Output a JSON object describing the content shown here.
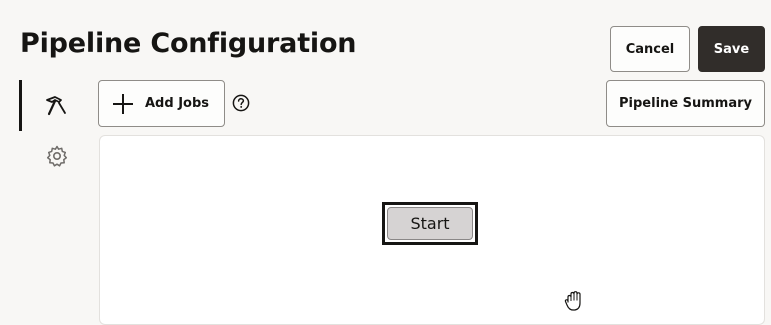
{
  "header": {
    "title": "Pipeline Configuration",
    "cancel_label": "Cancel",
    "save_label": "Save"
  },
  "toolbar": {
    "add_jobs_label": "Add Jobs",
    "pipeline_summary_label": "Pipeline Summary"
  },
  "sidebar": {
    "items": [
      {
        "icon": "hammer-build-icon",
        "selected": true
      },
      {
        "icon": "gear-icon",
        "selected": false
      }
    ]
  },
  "canvas": {
    "start_node_label": "Start",
    "cursor": "grab-hand-icon"
  },
  "colors": {
    "background": "#f8f7f5",
    "save_button": "#312d2a",
    "node_fill": "#d6d3d3"
  }
}
